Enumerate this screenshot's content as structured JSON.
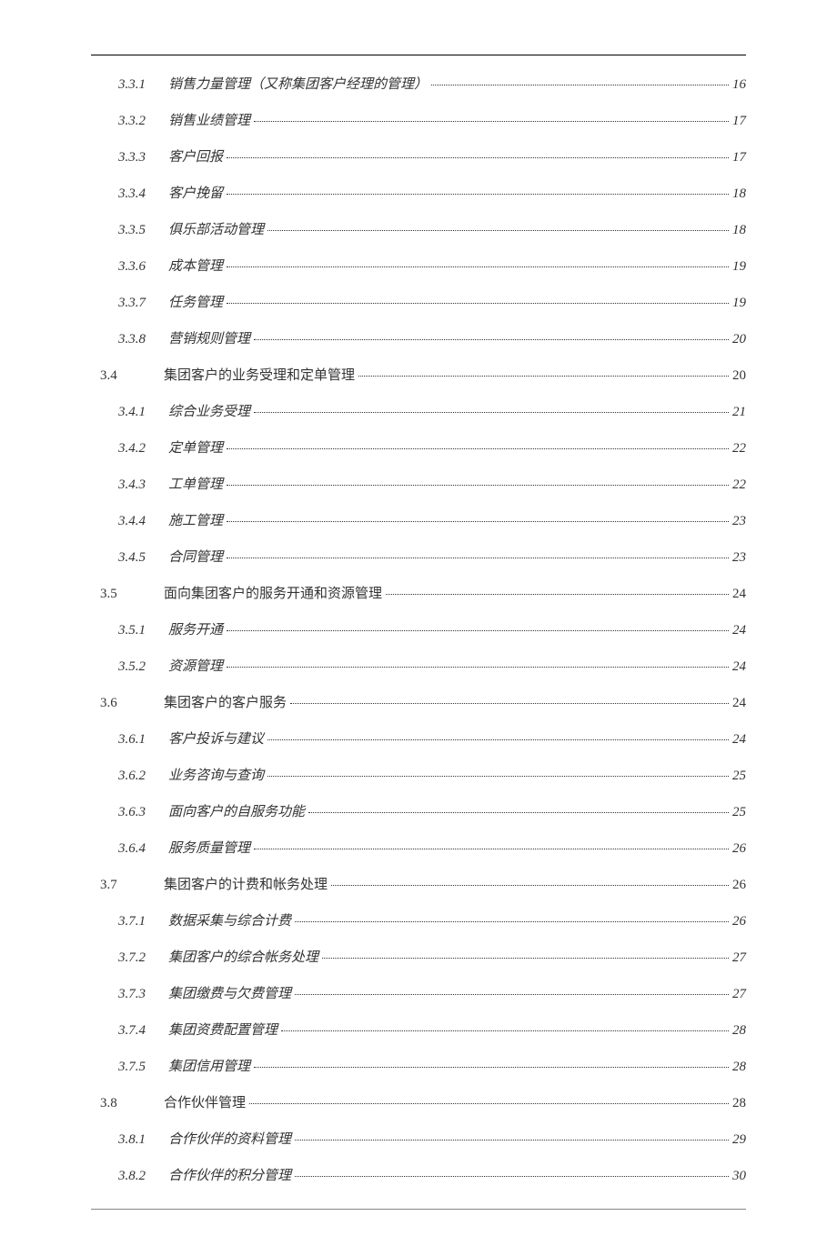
{
  "toc": [
    {
      "num": "3.3.1",
      "title": "销售力量管理（又称集团客户经理的管理）",
      "page": "16",
      "level": "sub"
    },
    {
      "num": "3.3.2",
      "title": "销售业绩管理",
      "page": "17",
      "level": "sub"
    },
    {
      "num": "3.3.3",
      "title": "客户回报",
      "page": "17",
      "level": "sub"
    },
    {
      "num": "3.3.4",
      "title": "客户挽留",
      "page": "18",
      "level": "sub"
    },
    {
      "num": "3.3.5",
      "title": "俱乐部活动管理",
      "page": "18",
      "level": "sub"
    },
    {
      "num": "3.3.6",
      "title": "成本管理",
      "page": "19",
      "level": "sub"
    },
    {
      "num": "3.3.7",
      "title": "任务管理",
      "page": "19",
      "level": "sub"
    },
    {
      "num": "3.3.8",
      "title": "营销规则管理",
      "page": "20",
      "level": "sub"
    },
    {
      "num": "3.4",
      "title": "集团客户的业务受理和定单管理",
      "page": "20",
      "level": "main"
    },
    {
      "num": "3.4.1",
      "title": "综合业务受理",
      "page": "21",
      "level": "sub"
    },
    {
      "num": "3.4.2",
      "title": "定单管理",
      "page": "22",
      "level": "sub"
    },
    {
      "num": "3.4.3",
      "title": "工单管理",
      "page": "22",
      "level": "sub"
    },
    {
      "num": "3.4.4",
      "title": "施工管理",
      "page": "23",
      "level": "sub"
    },
    {
      "num": "3.4.5",
      "title": "合同管理",
      "page": "23",
      "level": "sub"
    },
    {
      "num": "3.5",
      "title": "面向集团客户的服务开通和资源管理",
      "page": "24",
      "level": "main"
    },
    {
      "num": "3.5.1",
      "title": "服务开通",
      "page": "24",
      "level": "sub"
    },
    {
      "num": "3.5.2",
      "title": "资源管理",
      "page": "24",
      "level": "sub"
    },
    {
      "num": "3.6",
      "title": "集团客户的客户服务",
      "page": "24",
      "level": "main"
    },
    {
      "num": "3.6.1",
      "title": "客户投诉与建议",
      "page": "24",
      "level": "sub"
    },
    {
      "num": "3.6.2",
      "title": "业务咨询与查询",
      "page": "25",
      "level": "sub"
    },
    {
      "num": "3.6.3",
      "title": "面向客户的自服务功能",
      "page": "25",
      "level": "sub"
    },
    {
      "num": "3.6.4",
      "title": "服务质量管理",
      "page": "26",
      "level": "sub"
    },
    {
      "num": "3.7",
      "title": "集团客户的计费和帐务处理",
      "page": "26",
      "level": "main"
    },
    {
      "num": "3.7.1",
      "title": "数据采集与综合计费",
      "page": "26",
      "level": "sub"
    },
    {
      "num": "3.7.2",
      "title": "集团客户的综合帐务处理",
      "page": "27",
      "level": "sub"
    },
    {
      "num": "3.7.3",
      "title": "集团缴费与欠费管理",
      "page": "27",
      "level": "sub"
    },
    {
      "num": "3.7.4",
      "title": "集团资费配置管理",
      "page": "28",
      "level": "sub"
    },
    {
      "num": "3.7.5",
      "title": "集团信用管理",
      "page": "28",
      "level": "sub"
    },
    {
      "num": "3.8",
      "title": "合作伙伴管理",
      "page": "28",
      "level": "main"
    },
    {
      "num": "3.8.1",
      "title": "合作伙伴的资料管理",
      "page": "29",
      "level": "sub"
    },
    {
      "num": "3.8.2",
      "title": "合作伙伴的积分管理",
      "page": "30",
      "level": "sub"
    }
  ]
}
